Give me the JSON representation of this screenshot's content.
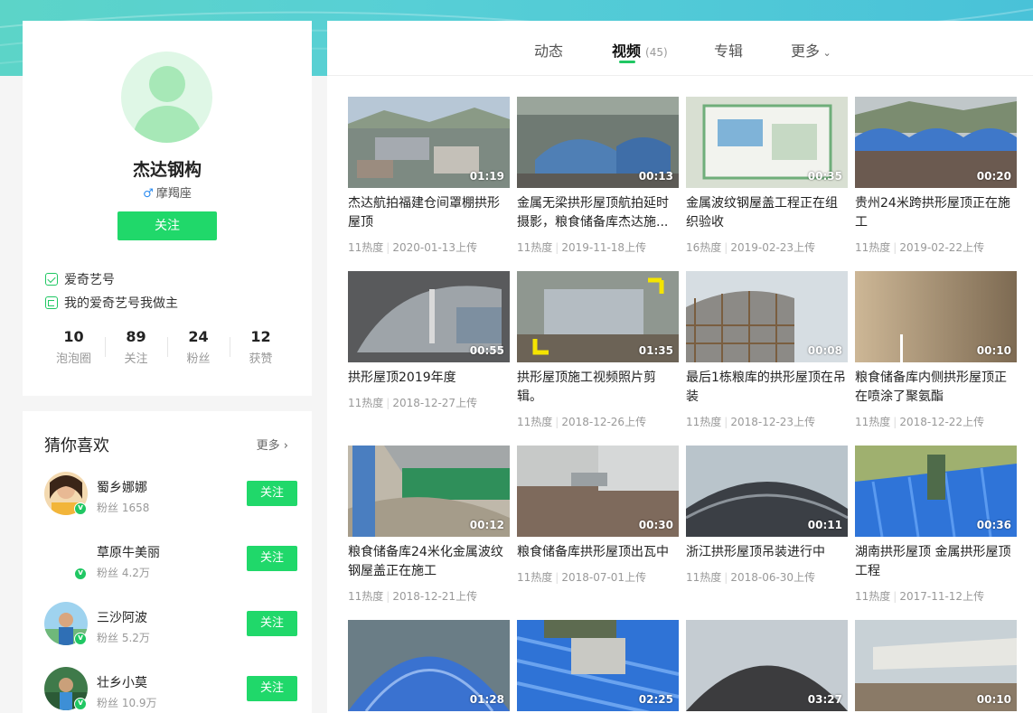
{
  "colors": {
    "accent": "#20d86a",
    "banner": "#55ced4",
    "verified": "#20c763"
  },
  "profile": {
    "name": "杰达钢构",
    "gender_icon": "male-icon",
    "gender_symbol": "♂",
    "zodiac": "摩羯座",
    "follow_label": "关注",
    "badges": [
      {
        "icon": "iqiyi-account-icon",
        "label": "爱奇艺号"
      },
      {
        "icon": "document-icon",
        "label": "我的爱奇艺号我做主"
      }
    ],
    "stats": [
      {
        "value": "10",
        "label": "泡泡圈"
      },
      {
        "value": "89",
        "label": "关注"
      },
      {
        "value": "24",
        "label": "粉丝"
      },
      {
        "value": "12",
        "label": "获赞"
      }
    ]
  },
  "guess": {
    "title": "猜你喜欢",
    "more_label": "更多",
    "items": [
      {
        "name": "蜀乡娜娜",
        "fans": "粉丝 1658",
        "follow": "关注"
      },
      {
        "name": "草原牛美丽",
        "fans": "粉丝 4.2万",
        "follow": "关注"
      },
      {
        "name": "三沙阿波",
        "fans": "粉丝 5.2万",
        "follow": "关注"
      },
      {
        "name": "壮乡小莫",
        "fans": "粉丝 10.9万",
        "follow": "关注"
      }
    ]
  },
  "tabs": [
    {
      "label": "动态",
      "count": ""
    },
    {
      "label": "视频",
      "count": "(45)"
    },
    {
      "label": "专辑",
      "count": ""
    },
    {
      "label": "更多",
      "count": ""
    }
  ],
  "videos": [
    {
      "title": "杰达航拍福建仓间罩棚拱形屋顶",
      "duration": "01:19",
      "heat": "11热度",
      "date": "2020-01-13上传"
    },
    {
      "title": "金属无梁拱形屋顶航拍延时摄影，粮食储备库杰达施...",
      "duration": "00:13",
      "heat": "11热度",
      "date": "2019-11-18上传"
    },
    {
      "title": "金属波纹钢屋盖工程正在组织验收",
      "duration": "00:35",
      "heat": "16热度",
      "date": "2019-02-23上传"
    },
    {
      "title": "贵州24米跨拱形屋顶正在施工",
      "duration": "00:20",
      "heat": "11热度",
      "date": "2019-02-22上传"
    },
    {
      "title": "拱形屋顶2019年度",
      "duration": "00:55",
      "heat": "11热度",
      "date": "2018-12-27上传"
    },
    {
      "title": "拱形屋顶施工视频照片剪辑。",
      "duration": "01:35",
      "heat": "11热度",
      "date": "2018-12-26上传"
    },
    {
      "title": "最后1栋粮库的拱形屋顶在吊装",
      "duration": "00:08",
      "heat": "11热度",
      "date": "2018-12-23上传"
    },
    {
      "title": "粮食储备库内侧拱形屋顶正在喷涂了聚氨酯",
      "duration": "00:10",
      "heat": "11热度",
      "date": "2018-12-22上传"
    },
    {
      "title": "粮食储备库24米化金属波纹钢屋盖正在施工",
      "duration": "00:12",
      "heat": "11热度",
      "date": "2018-12-21上传"
    },
    {
      "title": "粮食储备库拱形屋顶出瓦中",
      "duration": "00:30",
      "heat": "11热度",
      "date": "2018-07-01上传"
    },
    {
      "title": "浙江拱形屋顶吊装进行中",
      "duration": "00:11",
      "heat": "11热度",
      "date": "2018-06-30上传"
    },
    {
      "title": "湖南拱形屋顶 金属拱形屋顶工程",
      "duration": "00:36",
      "heat": "11热度",
      "date": "2017-11-12上传"
    },
    {
      "title": "",
      "duration": "01:28",
      "heat": "",
      "date": ""
    },
    {
      "title": "",
      "duration": "02:25",
      "heat": "",
      "date": ""
    },
    {
      "title": "",
      "duration": "03:27",
      "heat": "",
      "date": ""
    },
    {
      "title": "",
      "duration": "00:10",
      "heat": "",
      "date": ""
    }
  ]
}
